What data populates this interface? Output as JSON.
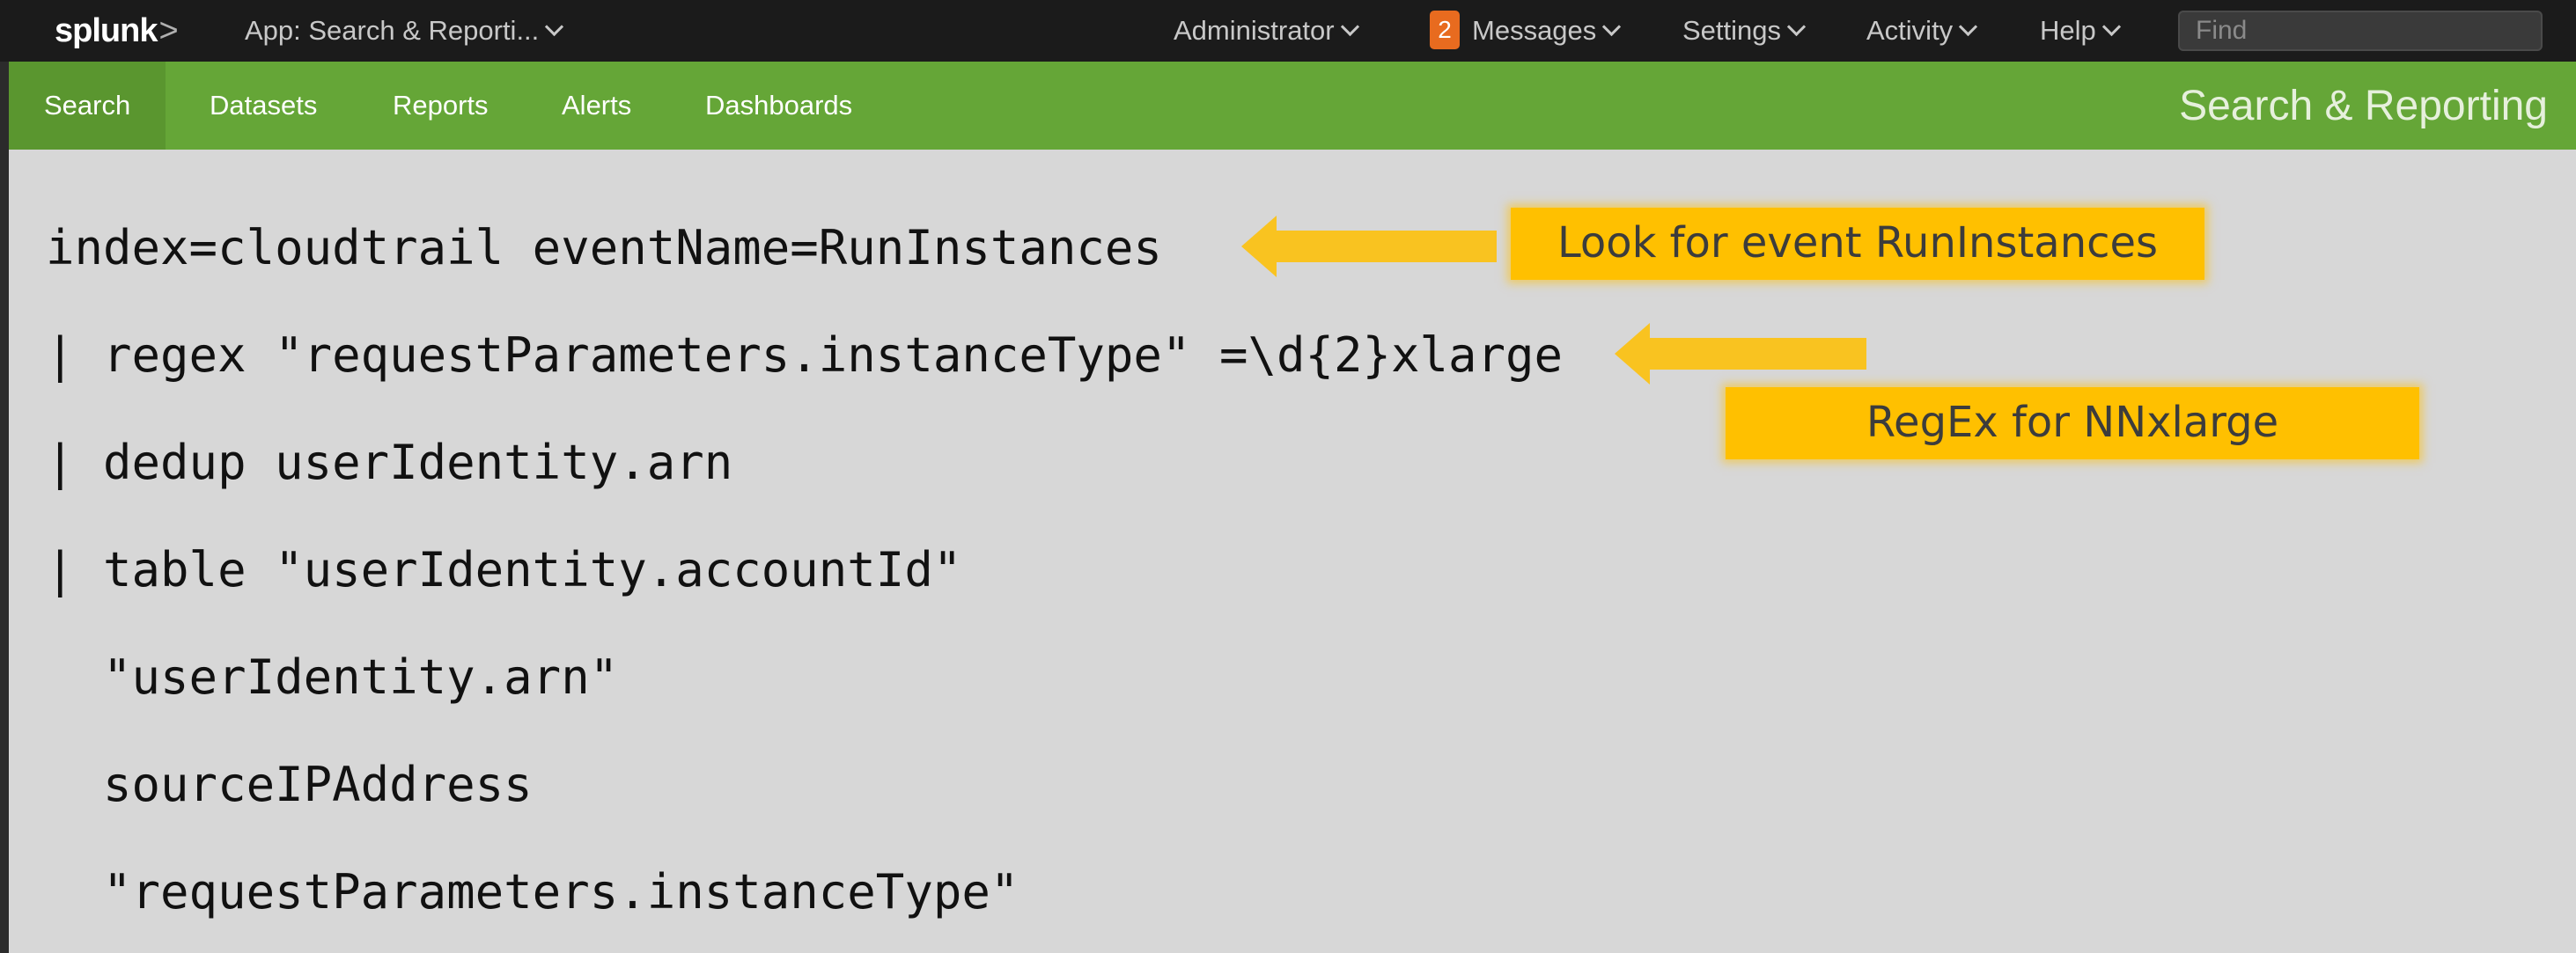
{
  "topbar": {
    "logo": "splunk",
    "logo_suffix": ">",
    "app_menu": "App: Search & Reporti...",
    "user_menu": "Administrator",
    "messages_count": "2",
    "messages_menu": "Messages",
    "settings_menu": "Settings",
    "activity_menu": "Activity",
    "help_menu": "Help",
    "find_placeholder": "Find"
  },
  "appbar": {
    "nav": [
      "Search",
      "Datasets",
      "Reports",
      "Alerts",
      "Dashboards"
    ],
    "active": "Search",
    "app_title": "Search & Reporting",
    "color": "#65a637"
  },
  "query": {
    "lines": [
      "index=cloudtrail eventName=RunInstances",
      "| regex \"requestParameters.instanceType\" =\\d{2}xlarge",
      "| dedup userIdentity.arn",
      "| table \"userIdentity.accountId\"",
      "  \"userIdentity.arn\"",
      "  sourceIPAddress",
      "  \"requestParameters.instanceType\""
    ]
  },
  "annotations": {
    "callout1": "Look for event RunInstances",
    "callout2": "RegEx for NNxlarge",
    "color": "#ffc000"
  }
}
